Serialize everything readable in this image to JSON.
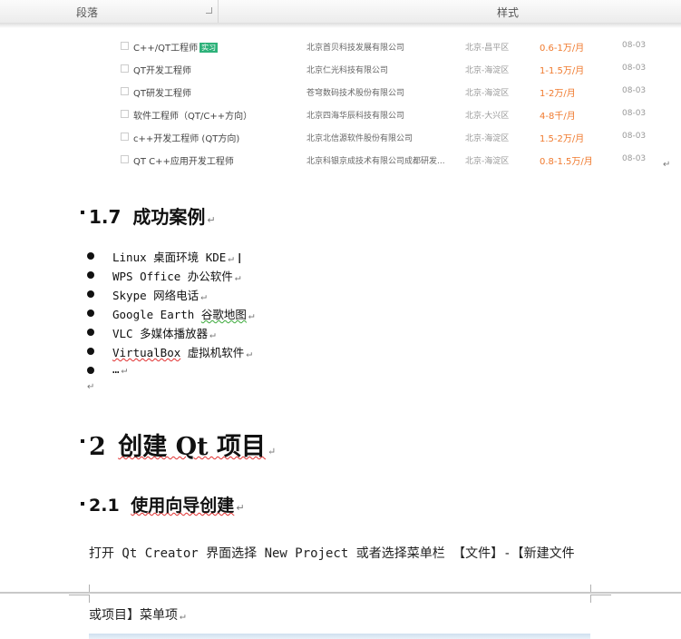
{
  "ribbon": {
    "paragraph_label": "段落",
    "style_label": "样式"
  },
  "job_listings": [
    {
      "title": "C++/QT工程师",
      "tag": "实习",
      "company": "北京首贝科技发展有限公司",
      "location": "北京-昌平区",
      "salary": "0.6-1万/月",
      "date": "08-03"
    },
    {
      "title": "QT开发工程师",
      "tag": "",
      "company": "北京仁光科技有限公司",
      "location": "北京-海淀区",
      "salary": "1-1.5万/月",
      "date": "08-03"
    },
    {
      "title": "QT研发工程师",
      "tag": "",
      "company": "苍穹数码技术股份有限公司",
      "location": "北京-海淀区",
      "salary": "1-2万/月",
      "date": "08-03"
    },
    {
      "title": "软件工程师（QT/C++方向）",
      "tag": "",
      "company": "北京四海华辰科技有限公司",
      "location": "北京-大兴区",
      "salary": "4-8千/月",
      "date": "08-03"
    },
    {
      "title": "c++开发工程师 (QT方向)",
      "tag": "",
      "company": "北京北信源软件股份有限公司",
      "location": "北京-海淀区",
      "salary": "1.5-2万/月",
      "date": "08-03"
    },
    {
      "title": "QT C++应用开发工程师",
      "tag": "",
      "company": "北京科银京成技术有限公司成都研发...",
      "location": "北京-海淀区",
      "salary": "0.8-1.5万/月",
      "date": "08-03"
    }
  ],
  "para_mark": "↵",
  "section_1_7": {
    "number": "1.7",
    "title": "成功案例"
  },
  "cases": [
    {
      "app": "Linux",
      "desc": "桌面环境 KDE"
    },
    {
      "app": "WPS Office",
      "desc": "办公软件"
    },
    {
      "app": "Skype",
      "desc": "网络电话"
    },
    {
      "app": "Google Earth",
      "desc": "谷歌地图"
    },
    {
      "app": "VLC",
      "desc": "多媒体播放器"
    },
    {
      "app": "VirtualBox",
      "desc": "虚拟机软件"
    },
    {
      "app": "…",
      "desc": ""
    }
  ],
  "section_2": {
    "number": "2",
    "title": "创建 Qt 项目"
  },
  "section_2_1": {
    "number": "2.1",
    "title": "使用向导创建"
  },
  "body": {
    "line1": "打开 Qt Creator 界面选择 New Project 或者选择菜单栏 【文件】-【新建文件",
    "line2": "或项目】菜单项"
  }
}
